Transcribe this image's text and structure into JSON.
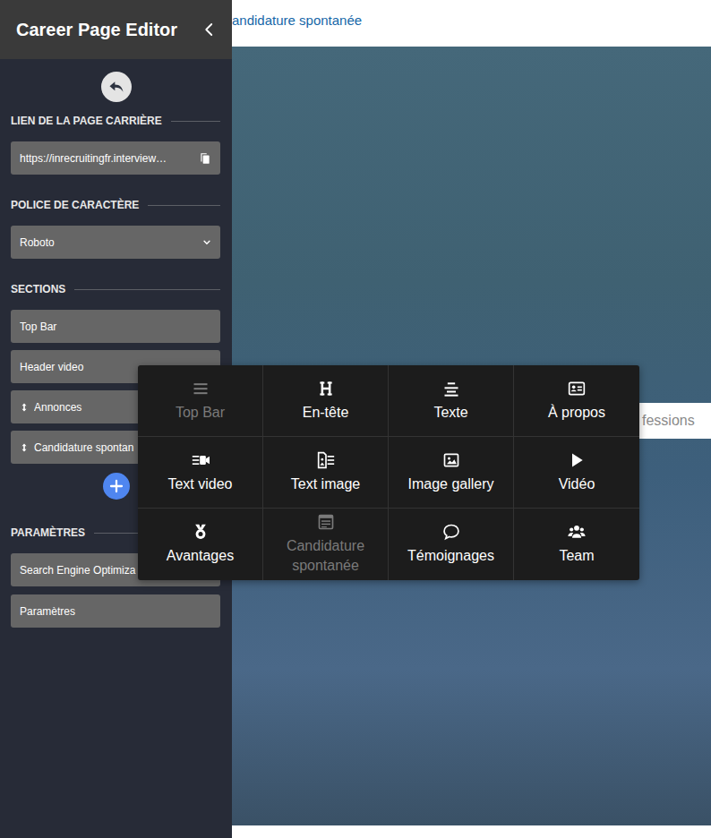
{
  "sidebar": {
    "title": "Career Page Editor",
    "link": {
      "label": "LIEN DE LA PAGE CARRIÈRE",
      "value": "https://inrecruitingfr.interview…"
    },
    "font": {
      "label": "POLICE DE CARACTÈRE",
      "value": "Roboto"
    },
    "sections": {
      "label": "SECTIONS",
      "items": [
        {
          "label": "Top Bar",
          "draggable": false
        },
        {
          "label": "Header video",
          "draggable": false
        },
        {
          "label": "Annonces",
          "draggable": true
        },
        {
          "label": "Candidature spontan",
          "draggable": true
        }
      ]
    },
    "settings": {
      "label": "PARAMÈTRES",
      "items": [
        "Search Engine Optimiza",
        "Paramètres"
      ]
    }
  },
  "preview": {
    "top_link": "andidature spontanée",
    "search_text": "fessions"
  },
  "add_menu": {
    "items": [
      {
        "label": "Top Bar",
        "disabled": true
      },
      {
        "label": "En-tête",
        "disabled": false
      },
      {
        "label": "Texte",
        "disabled": false
      },
      {
        "label": "À propos",
        "disabled": false
      },
      {
        "label": "Text video",
        "disabled": false
      },
      {
        "label": "Text image",
        "disabled": false
      },
      {
        "label": "Image gallery",
        "disabled": false
      },
      {
        "label": "Vidéo",
        "disabled": false
      },
      {
        "label": "Avantages",
        "disabled": false
      },
      {
        "label": "Candidature spontanée",
        "disabled": true
      },
      {
        "label": "Témoignages",
        "disabled": false
      },
      {
        "label": "Team",
        "disabled": false
      }
    ]
  }
}
